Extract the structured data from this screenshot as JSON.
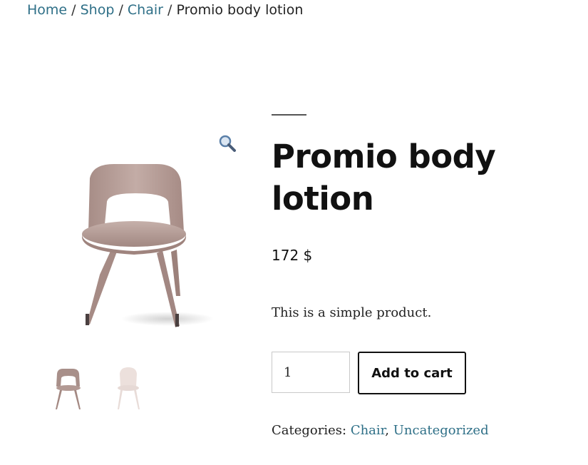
{
  "breadcrumb": {
    "items": [
      "Home",
      "Shop",
      "Chair"
    ],
    "separator": "/",
    "current": "Promio body lotion"
  },
  "gallery": {
    "main_image": "chair-mauve",
    "zoom_icon": "magnifier-icon",
    "thumbnails": [
      "chair-mauve",
      "chair-white"
    ]
  },
  "product": {
    "title": "Promio body lotion",
    "price": "172 $",
    "short_description": "This is a simple product."
  },
  "cart": {
    "quantity": "1",
    "add_label": "Add to cart"
  },
  "meta": {
    "categories_label": "Categories:",
    "categories": [
      "Chair",
      "Uncategorized"
    ],
    "category_separator": ","
  },
  "colors": {
    "link": "#2e6f87",
    "chair_mauve": "#b79f99",
    "chair_white": "#eee3df"
  }
}
